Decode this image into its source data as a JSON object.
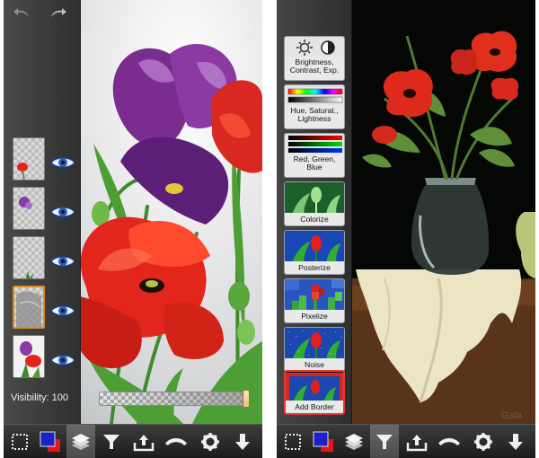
{
  "left_screen": {
    "layers_panel": {
      "undo_icon": "undo-arrow-icon",
      "redo_icon": "redo-arrow-icon",
      "layers": [
        {
          "thumbnail": "poppy-layer",
          "visible": true
        },
        {
          "thumbnail": "purple-flower-layer",
          "visible": true
        },
        {
          "thumbnail": "grass-layer",
          "visible": true
        },
        {
          "thumbnail": "sketch-layer",
          "visible": true,
          "selected": true
        },
        {
          "thumbnail": "bouquet-layer",
          "visible": true
        }
      ]
    },
    "visibility": {
      "label": "Visibility: 100",
      "value": 100
    }
  },
  "right_screen": {
    "effects": [
      {
        "label": "Brightness, Contrast, Exp.",
        "icon": "sun-contrast-icon"
      },
      {
        "label": "Hue, Saturat., Lightness",
        "icon": "hue-gradient-icon"
      },
      {
        "label": "Red, Green, Blue",
        "icon": "rgb-bars-icon"
      },
      {
        "label": "Colorize",
        "icon": "colorize-preview"
      },
      {
        "label": "Posterize",
        "icon": "posterize-preview"
      },
      {
        "label": "Pixelize",
        "icon": "pixelize-preview"
      },
      {
        "label": "Noise",
        "icon": "noise-preview"
      },
      {
        "label": "Add Border",
        "icon": "border-preview",
        "highlighted": true
      }
    ],
    "watermark": "Gala"
  },
  "toolbar": {
    "buttons": [
      "selection-icon",
      "color-swatch-icon",
      "layers-icon",
      "filter-icon",
      "import-export-icon",
      "brush-settings-icon",
      "gear-icon",
      "download-arrow-icon"
    ],
    "colors": {
      "primary": "#1b21c9",
      "secondary": "#e4161a"
    }
  }
}
